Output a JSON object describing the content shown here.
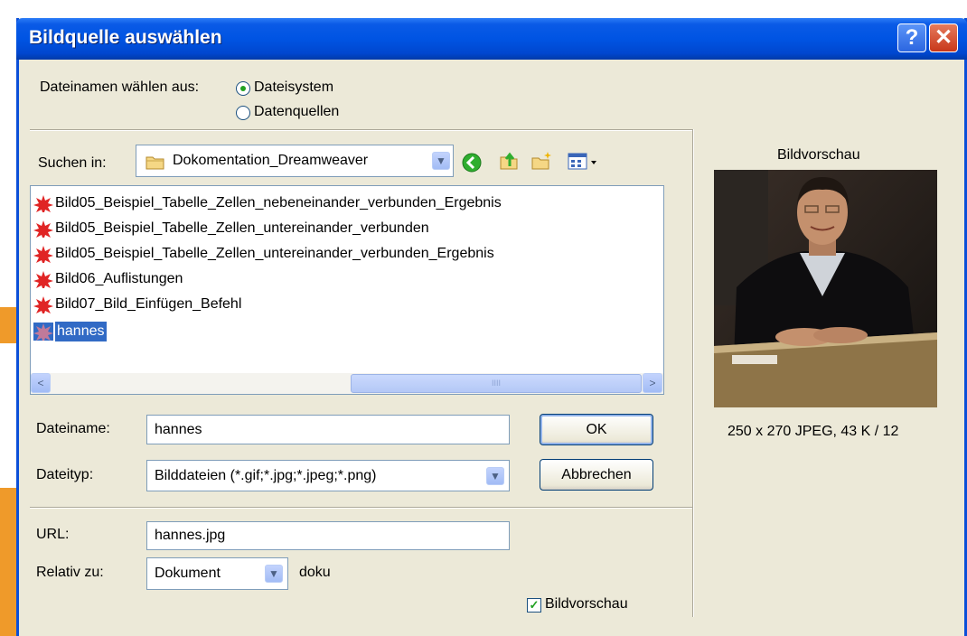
{
  "window": {
    "title": "Bildquelle auswählen",
    "help_glyph": "?",
    "close_glyph": "✕"
  },
  "source": {
    "label": "Dateinamen wählen aus:",
    "options": [
      {
        "label": "Dateisystem",
        "checked": true
      },
      {
        "label": "Datenquellen",
        "checked": false
      }
    ]
  },
  "lookin": {
    "label": "Suchen in:",
    "folder": "Dokomentation_Dreamweaver",
    "icons": [
      "back-icon",
      "up-folder-icon",
      "new-folder-icon",
      "view-menu-icon"
    ]
  },
  "files": [
    {
      "name": "Bild05_Beispiel_Tabelle_Zellen_nebeneinander_verbunden_Ergebnis",
      "selected": false
    },
    {
      "name": "Bild05_Beispiel_Tabelle_Zellen_untereinander_verbunden",
      "selected": false
    },
    {
      "name": "Bild05_Beispiel_Tabelle_Zellen_untereinander_verbunden_Ergebnis",
      "selected": false
    },
    {
      "name": "Bild06_Auflistungen",
      "selected": false
    },
    {
      "name": "Bild07_Bild_Einfügen_Befehl",
      "selected": false
    },
    {
      "name": "hannes",
      "selected": true
    }
  ],
  "scrollbar": {
    "left": "<",
    "right": ">",
    "grip": "IIII"
  },
  "form": {
    "filename_label": "Dateiname:",
    "filename_value": "hannes",
    "filetype_label": "Dateityp:",
    "filetype_value": "Bilddateien (*.gif;*.jpg;*.jpeg;*.png)",
    "ok": "OK",
    "cancel": "Abbrechen",
    "url_label": "URL:",
    "url_value": "hannes.jpg",
    "relative_label": "Relativ zu:",
    "relative_value": "Dokument",
    "relative_doc": "doku",
    "preview_checkbox": "Bildvorschau",
    "preview_checked": true
  },
  "preview": {
    "title": "Bildvorschau",
    "info": "250 x 270 JPEG, 43 K / 12"
  },
  "colors": {
    "titlebar": "#0054e3",
    "dialog_bg": "#ece9d8",
    "selection": "#316ac5",
    "radio_dot": "#21a121"
  }
}
